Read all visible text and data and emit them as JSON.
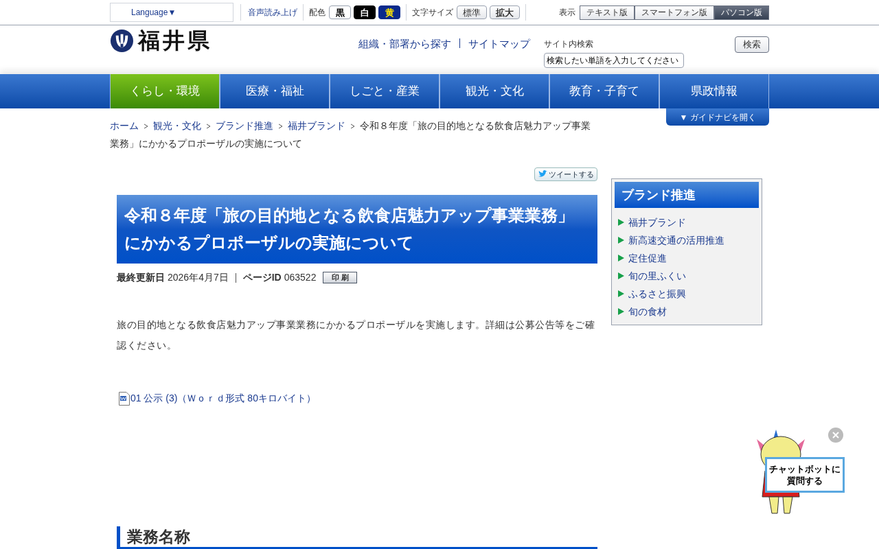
{
  "utility_bar": {
    "language": "Language▼",
    "speech": "音声読み上げ",
    "color_label": "配色",
    "color_options": [
      {
        "label": "黒",
        "kind": "black"
      },
      {
        "label": "白",
        "kind": "white"
      },
      {
        "label": "黄",
        "kind": "yellow"
      }
    ],
    "size_label": "文字サイズ",
    "size_options": [
      {
        "label": "標準",
        "bold": false
      },
      {
        "label": "拡大",
        "bold": true
      }
    ],
    "view_label": "表示",
    "view_options": [
      {
        "label": "テキスト版",
        "selected": false
      },
      {
        "label": "スマートフォン版",
        "selected": false
      },
      {
        "label": "パソコン版",
        "selected": true
      }
    ]
  },
  "header": {
    "logo_text": "福井県",
    "links": [
      "組織・部署から探す",
      "サイトマップ"
    ],
    "search_label": "サイト内検索",
    "search_value": "検索したい単語を入力してください",
    "search_button": "検索"
  },
  "nav": [
    {
      "label": "くらし・環境",
      "selected": true
    },
    {
      "label": "医療・福祉",
      "selected": false
    },
    {
      "label": "しごと・産業",
      "selected": false
    },
    {
      "label": "観光・文化",
      "selected": false
    },
    {
      "label": "教育・子育て",
      "selected": false
    },
    {
      "label": "県政情報",
      "selected": false
    }
  ],
  "guide_button": "▼ ガイドナビを開く",
  "breadcrumb": {
    "links": [
      "ホーム",
      "観光・文化",
      "ブランド推進",
      "福井ブランド"
    ],
    "current": "令和８年度「旅の目的地となる飲食店魅力アップ事業業務」にかかるプロポーザルの実施について"
  },
  "tweet_button": "ツイートする",
  "title": "令和８年度「旅の目的地となる飲食店魅力アップ事業業務」にかかるプロポーザルの実施について",
  "meta": {
    "updated_label": "最終更新日",
    "updated": "2026年4月7日",
    "page_id_label": "ページID",
    "page_id": "063522",
    "print_button": "印 刷"
  },
  "body": "旅の目的地となる飲食店魅力アップ事業業務にかかるプロポーザルを実施します。詳細は公募公告等をご確認ください。",
  "attachment": "01 公示 (3)（Ｗｏｒｄ形式 80キロバイト）",
  "section_heading": "業務名称",
  "sidebar": {
    "title": "ブランド推進",
    "items": [
      "福井ブランド",
      "新高速交通の活用推進",
      "定住促進",
      "旬の里ふくい",
      "ふるさと振興",
      "旬の食材"
    ]
  },
  "chatbot": {
    "sign": "チャットボットに質問する"
  }
}
